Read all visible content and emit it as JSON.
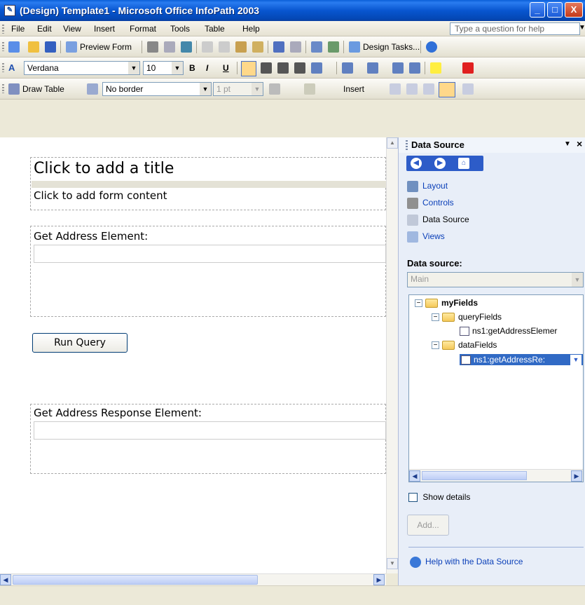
{
  "window": {
    "title": "(Design) Template1 - Microsoft Office InfoPath 2003",
    "min": "_",
    "max": "□",
    "close": "X"
  },
  "menubar": {
    "items": [
      "File",
      "Edit",
      "View",
      "Insert",
      "Format",
      "Tools",
      "Table",
      "Help"
    ],
    "help_placeholder": "Type a question for help"
  },
  "toolbar_standard": {
    "preview_label": "Preview Form",
    "design_tasks_label": "Design Tasks..."
  },
  "toolbar_format": {
    "font": "Verdana",
    "size": "10",
    "bold": "B",
    "italic": "I",
    "underline": "U"
  },
  "toolbar_table": {
    "draw_table": "Draw Table",
    "border_style": "No border",
    "border_width": "1 pt",
    "insert_label": "Insert"
  },
  "form": {
    "title": "Click to add a title",
    "content": "Click to add form content",
    "section1_label": "Get Address Element:",
    "run_button": "Run Query",
    "section2_label": "Get Address Response Element:"
  },
  "task_pane": {
    "title": "Data Source",
    "links": [
      "Layout",
      "Controls",
      "Data Source",
      "Views"
    ],
    "data_source_label": "Data source:",
    "data_source_value": "Main",
    "tree": {
      "root": "myFields",
      "query_fields": "queryFields",
      "query_child": "ns1:getAddressElemer",
      "data_fields": "dataFields",
      "data_child": "ns1:getAddressRe:"
    },
    "show_details": "Show details",
    "add_button": "Add...",
    "help_link": "Help with the Data Source",
    "colors": {
      "pane_bg": "#e8eef8",
      "link": "#0a3fb8",
      "selection": "#316ac5"
    }
  }
}
